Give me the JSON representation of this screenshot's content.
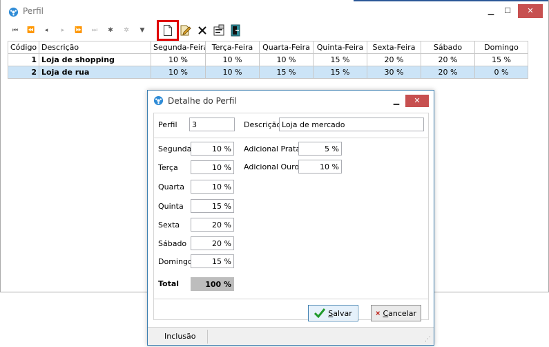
{
  "window": {
    "title": "Perfil",
    "accent_color": "#2b5797",
    "minimize_glyph": "▁",
    "maximize_glyph": "☐",
    "close_glyph": "✕"
  },
  "toolbar": {
    "buttons": [
      {
        "name": "first-record-icon",
        "glyph": "⏮"
      },
      {
        "name": "prev-page-icon",
        "glyph": "⏪"
      },
      {
        "name": "prev-record-icon",
        "glyph": "◂"
      },
      {
        "name": "next-record-icon",
        "glyph": "▸"
      },
      {
        "name": "next-page-icon",
        "glyph": "⏩"
      },
      {
        "name": "last-record-icon",
        "glyph": "⏭"
      },
      {
        "name": "asterisk-icon",
        "glyph": "✱"
      },
      {
        "name": "clear-asterisk-icon",
        "glyph": "✲"
      },
      {
        "name": "filter-icon",
        "glyph": "▼"
      }
    ],
    "highlight_color": "#e00000"
  },
  "grid": {
    "columns": [
      "Código",
      "Descrição",
      "Segunda-Feira",
      "Terça-Feira",
      "Quarta-Feira",
      "Quinta-Feira",
      "Sexta-Feira",
      "Sábado",
      "Domingo"
    ],
    "rows": [
      {
        "codigo": "1",
        "descricao": "Loja de shopping",
        "segunda": "10 %",
        "terca": "10 %",
        "quarta": "10 %",
        "quinta": "15 %",
        "sexta": "20 %",
        "sabado": "20 %",
        "domingo": "15 %"
      },
      {
        "codigo": "2",
        "descricao": "Loja de rua",
        "segunda": "10 %",
        "terca": "10 %",
        "quarta": "15 %",
        "quinta": "15 %",
        "sexta": "30 %",
        "sabado": "20 %",
        "domingo": "0 %"
      }
    ],
    "selected_row_color": "#cce4f7"
  },
  "dialog": {
    "title": "Detalhe do Perfil",
    "perfil_label": "Perfil",
    "perfil_value": "3",
    "descricao_label": "Descrição",
    "descricao_value": "Loja de mercado",
    "days": [
      {
        "label": "Segunda",
        "value": "10 %"
      },
      {
        "label": "Terça",
        "value": "10 %"
      },
      {
        "label": "Quarta",
        "value": "10 %"
      },
      {
        "label": "Quinta",
        "value": "15 %"
      },
      {
        "label": "Sexta",
        "value": "20 %"
      },
      {
        "label": "Sábado",
        "value": "20 %"
      },
      {
        "label": "Domingo",
        "value": "15 %"
      }
    ],
    "adicional_prata_label": "Adicional Prata",
    "adicional_prata_value": "5 %",
    "adicional_ouro_label": "Adicional Ouro",
    "adicional_ouro_value": "10 %",
    "total_label": "Total",
    "total_value": "100 %",
    "save_label_prefix": "",
    "save_label_ul": "S",
    "save_label_rest": "alvar",
    "cancel_label_ul": "C",
    "cancel_label_rest": "ancelar",
    "status": "Inclusão"
  }
}
